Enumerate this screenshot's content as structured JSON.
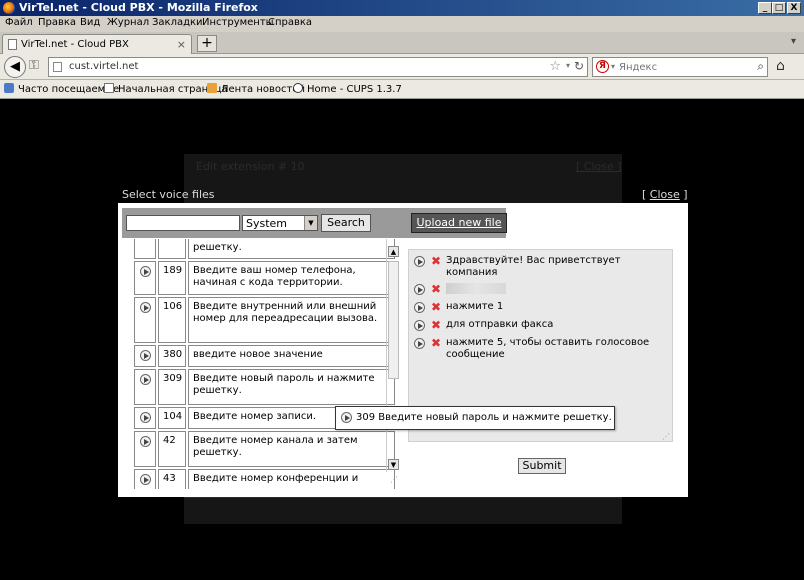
{
  "window": {
    "title": "VirTel.net - Cloud PBX - Mozilla Firefox",
    "buttons": {
      "minimize": "_",
      "maximize": "□",
      "close": "X"
    }
  },
  "menu": [
    "Файл",
    "Правка",
    "Вид",
    "Журнал",
    "Закладки",
    "Инструменты",
    "Справка"
  ],
  "tabs": {
    "active_label": "VirTel.net - Cloud PBX",
    "close_glyph": "×",
    "new_tab_glyph": "+",
    "list_glyph": "▾"
  },
  "nav": {
    "url": "cust.virtel.net",
    "search_placeholder": "Яндекс",
    "search_engine_letter": "Я"
  },
  "bookmarks": [
    "Часто посещаемые",
    "Начальная страница",
    "Лента новостей",
    "Home - CUPS 1.3.7"
  ],
  "background_page": {
    "extension_text": "Edit extension # 10",
    "close_text": "[ Close ]"
  },
  "dialog": {
    "title": "Select voice files",
    "close_text": "Close",
    "search_value": "",
    "category_selected": "System",
    "search_button": "Search",
    "upload_button": "Upload new file",
    "submit_button": "Submit",
    "file_list": [
      {
        "number": "",
        "text": "решетку."
      },
      {
        "number": "189",
        "text": "Введите ваш номер телефона, начиная с кода территории."
      },
      {
        "number": "106",
        "text": "Введите внутренний или внешний номер для переадресации вызова."
      },
      {
        "number": "380",
        "text": "введите новое значение"
      },
      {
        "number": "309",
        "text": "Введите новый пароль и нажмите решетку."
      },
      {
        "number": "104",
        "text": "Введите номер записи."
      },
      {
        "number": "42",
        "text": "Введите номер канала и затем решетку."
      },
      {
        "number": "43",
        "text": "Введите номер конференции и"
      }
    ],
    "selected_files": [
      {
        "text": "Здравствуйте! Вас приветствует компания"
      },
      {
        "text": ""
      },
      {
        "text": "нажмите 1"
      },
      {
        "text": "для отправки факса"
      },
      {
        "text": "нажмите 5, чтобы оставить голосовое сообщение"
      }
    ],
    "tooltip": "309 Введите новый пароль и нажмите решетку."
  }
}
